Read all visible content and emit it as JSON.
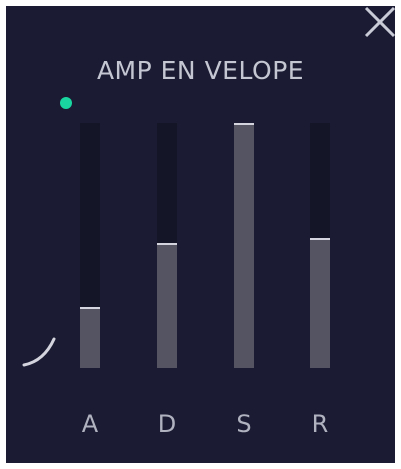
{
  "title": "AMP EN VELOPE",
  "close_icon": "close-icon",
  "indicator_color": "#19d6a0",
  "envelope": {
    "sliders": [
      {
        "label": "A",
        "value": 0.25
      },
      {
        "label": "D",
        "value": 0.51
      },
      {
        "label": "S",
        "value": 1.0
      },
      {
        "label": "R",
        "value": 0.53
      }
    ]
  }
}
